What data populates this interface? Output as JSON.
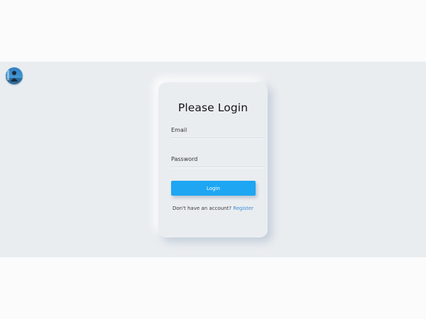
{
  "avatar": {
    "icon": "user-avatar-photo"
  },
  "login_card": {
    "title": "Please Login",
    "email": {
      "label": "Email",
      "value": ""
    },
    "password": {
      "label": "Password",
      "value": ""
    },
    "submit_label": "Login",
    "register_prompt": "Don't have an account?",
    "register_link": "Register"
  },
  "colors": {
    "page_background": "#fbfbfc",
    "panel_background": "#eaedf0",
    "button_accent": "#1ea6f2",
    "link": "#3b8ed6"
  }
}
